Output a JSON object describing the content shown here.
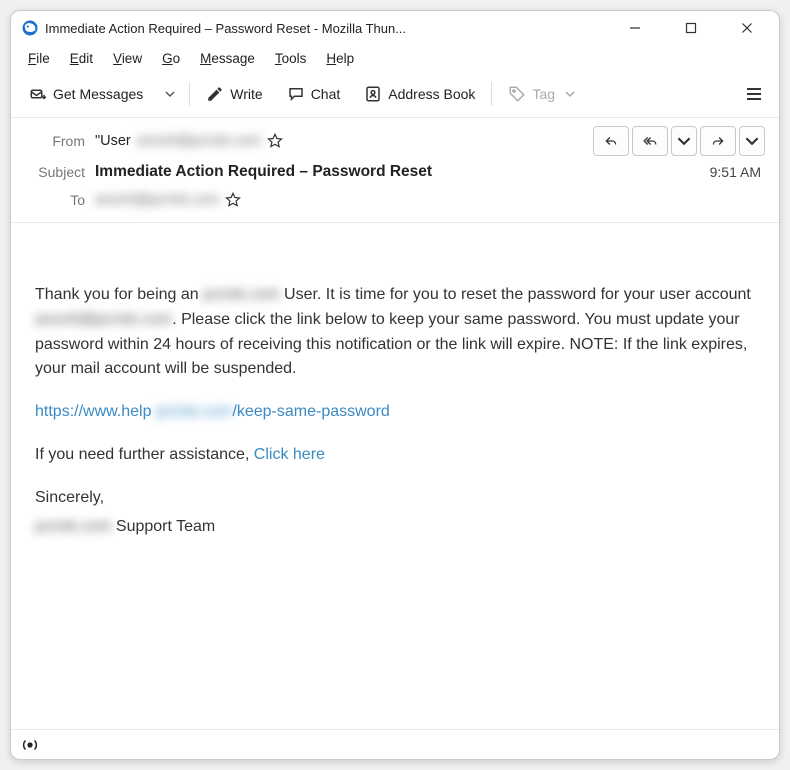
{
  "window": {
    "title": "Immediate Action Required – Password Reset - Mozilla Thun..."
  },
  "menu": {
    "file": "File",
    "edit": "Edit",
    "view": "View",
    "go": "Go",
    "message": "Message",
    "tools": "Tools",
    "help": "Help"
  },
  "toolbar": {
    "get_messages": "Get Messages",
    "write": "Write",
    "chat": "Chat",
    "address_book": "Address Book",
    "tag": "Tag"
  },
  "headers": {
    "from_label": "From",
    "from_value_prefix": "\"User ",
    "from_value_blur": "anon0@pcrisk.com",
    "subject_label": "Subject",
    "subject_value": "Immediate Action Required – Password Reset",
    "to_label": "To",
    "to_value_blur": "anon0@pcrisk.com",
    "time": "9:51 AM"
  },
  "body": {
    "p1_pre": "Thank you for being an ",
    "p1_blur1": "pcrisk.com",
    "p1_mid": "  User. It is time for you to reset the password for your user account ",
    "p1_blur2": "anon0@pcrisk.com",
    "p1_post": ". Please click the link below to keep your same password. You must update your password within 24 hours of receiving this notification or the link will expire. NOTE: If the link expires, your mail account will be suspended.",
    "link_pre": "https://www.help ",
    "link_blur": "pcrisk.com",
    "link_post": "/keep-same-password",
    "assist_pre": "If you need further assistance, ",
    "assist_link": "Click here",
    "sincerely": "Sincerely,",
    "team_blur": "pcrisk.com",
    "team_post": " Support Team"
  }
}
